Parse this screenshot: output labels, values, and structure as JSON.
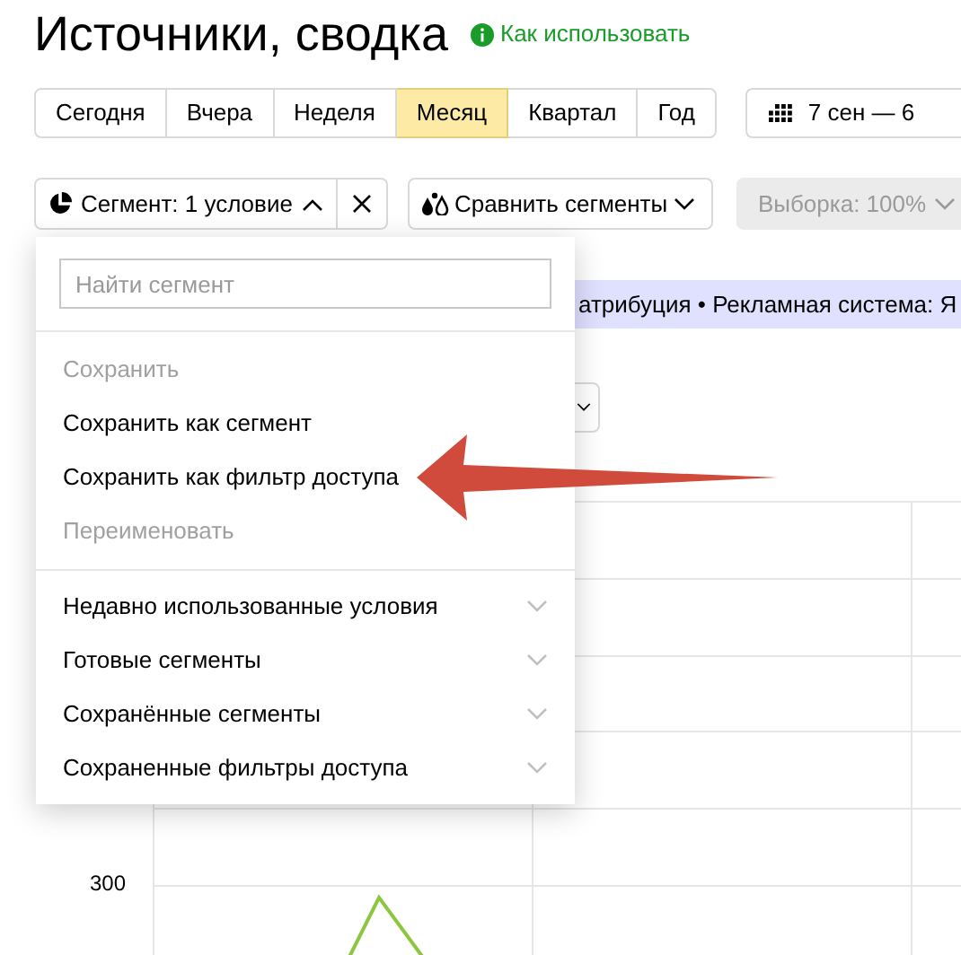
{
  "title": "Источники, сводка",
  "help_link": "Как использовать",
  "periods": [
    {
      "label": "Сегодня",
      "selected": false
    },
    {
      "label": "Вчера",
      "selected": false
    },
    {
      "label": "Неделя",
      "selected": false
    },
    {
      "label": "Месяц",
      "selected": true
    },
    {
      "label": "Квартал",
      "selected": false
    },
    {
      "label": "Год",
      "selected": false
    }
  ],
  "date_range": "7 сен — 6",
  "segment_button": {
    "label": "Сегмент: 1 условие",
    "expanded": true
  },
  "compare_button": "Сравнить сегменты",
  "sample_button": {
    "label": "Выборка: 100%",
    "disabled": true
  },
  "filter_banner": "атрибуция • Рекламная система: Я",
  "chart": {
    "y_ticks": [
      "300"
    ]
  },
  "segment_menu": {
    "search": {
      "placeholder": "Найти сегмент"
    },
    "actions": [
      {
        "label": "Сохранить",
        "disabled": true
      },
      {
        "label": "Сохранить как сегмент",
        "disabled": false
      },
      {
        "label": "Сохранить как фильтр доступа",
        "disabled": false
      },
      {
        "label": "Переименовать",
        "disabled": true
      }
    ],
    "sections": [
      {
        "label": "Недавно использованные условия",
        "expanded": false
      },
      {
        "label": "Готовые сегменты",
        "expanded": false
      },
      {
        "label": "Сохранённые сегменты",
        "expanded": false
      },
      {
        "label": "Сохраненные фильтры доступа",
        "expanded": false
      }
    ]
  }
}
